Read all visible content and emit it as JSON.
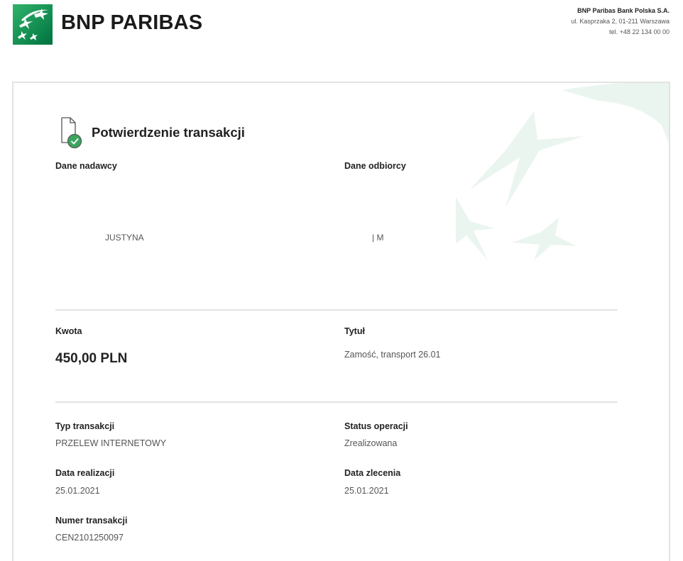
{
  "brand": {
    "name": "BNP PARIBAS",
    "accent_color": "#00915A"
  },
  "bank_info": {
    "name": "BNP Paribas Bank Polska S.A.",
    "address": "ul. Kasprzaka 2, 01-211 Warszawa",
    "phone": "tel. +48 22 134 00 00"
  },
  "document": {
    "title": "Potwierdzenie transakcji",
    "icon": "document-check-icon"
  },
  "sender": {
    "label": "Dane nadawcy",
    "value": "JUSTYNA"
  },
  "recipient": {
    "label": "Dane odbiorcy",
    "value": "| M"
  },
  "amount": {
    "label": "Kwota",
    "value": "450,00 PLN"
  },
  "title_field": {
    "label": "Tytuł",
    "value": "Zamość, transport 26.01"
  },
  "transaction_type": {
    "label": "Typ transakcji",
    "value": "PRZELEW INTERNETOWY"
  },
  "operation_status": {
    "label": "Status operacji",
    "value": "Zrealizowana"
  },
  "execution_date": {
    "label": "Data realizacji",
    "value": "25.01.2021"
  },
  "order_date": {
    "label": "Data zlecenia",
    "value": "25.01.2021"
  },
  "transaction_number": {
    "label": "Numer transakcji",
    "value": "CEN2101250097"
  }
}
